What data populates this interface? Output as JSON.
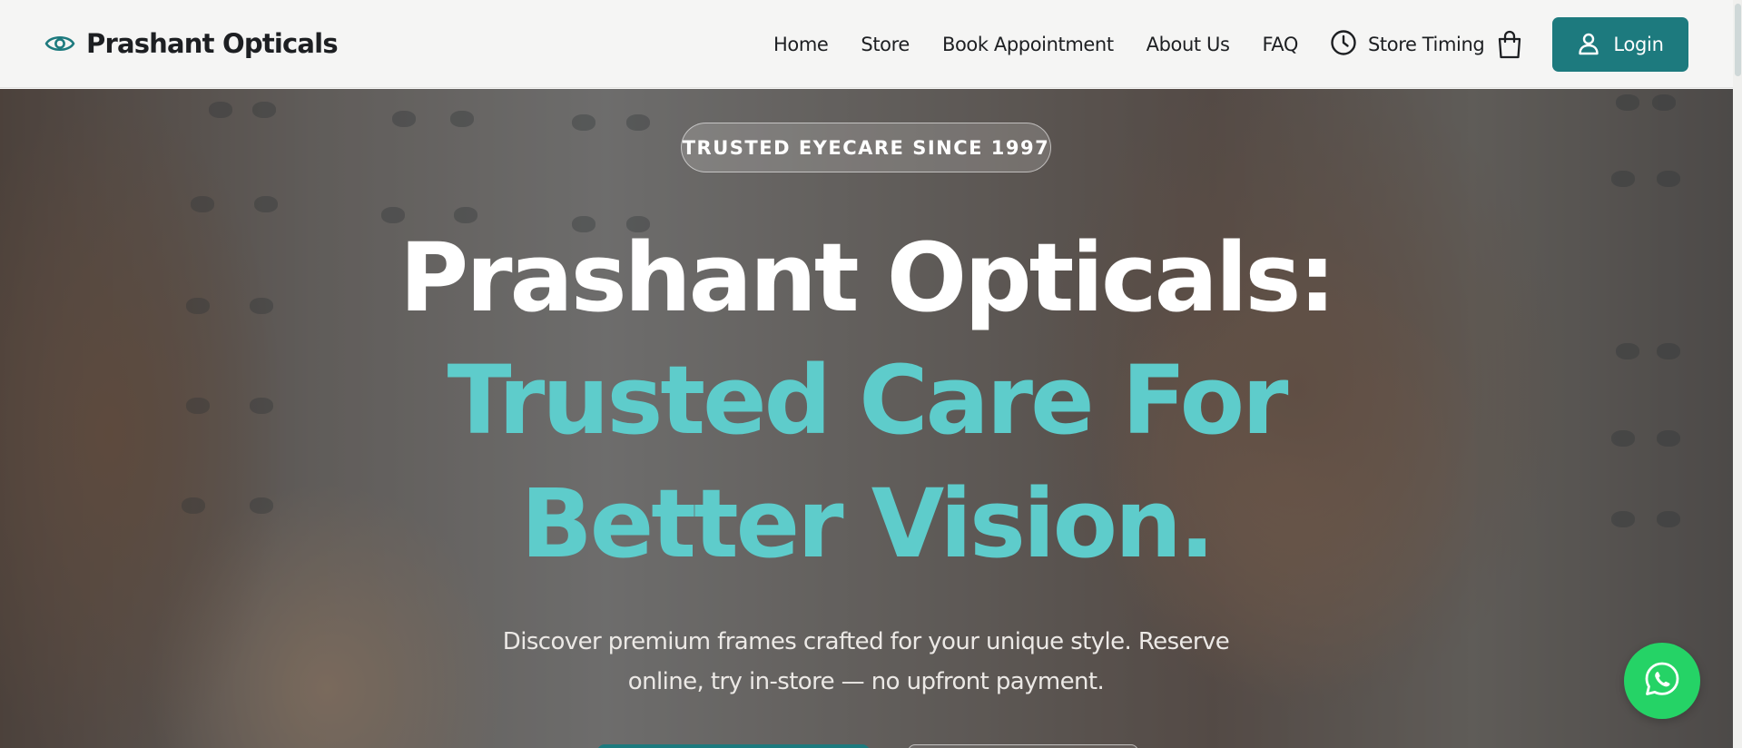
{
  "brand": {
    "name": "Prashant Opticals",
    "icon": "eye-icon",
    "accent_color": "#1d7a7e"
  },
  "nav": {
    "links": [
      "Home",
      "Store",
      "Book Appointment",
      "About Us",
      "FAQ"
    ],
    "store_timing": {
      "label": "Store Timing",
      "icon": "clock-icon"
    },
    "cart_icon": "shopping-bag-icon",
    "login": {
      "label": "Login",
      "icon": "user-icon"
    }
  },
  "hero": {
    "badge": "TRUSTED EYECARE SINCE 1997",
    "headline_line1": "Prashant Opticals:",
    "headline_line2": "Trusted Care For",
    "headline_line3": "Better Vision.",
    "headline_accent_color": "#5ecccb",
    "subtext_line1": "Discover premium frames crafted for your unique style. Reserve",
    "subtext_line2": "online, try in-store — no upfront payment."
  },
  "floating": {
    "whatsapp_icon": "whatsapp-icon",
    "whatsapp_color": "#25d366"
  }
}
